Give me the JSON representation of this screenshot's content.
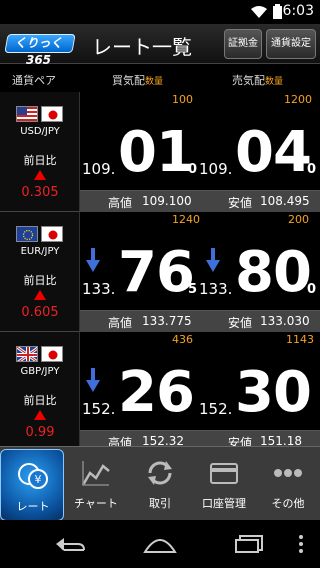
{
  "status": {
    "time": "16:03"
  },
  "header": {
    "logo": "くりっく365",
    "title": "レート一覧",
    "btn_margin": "証拠金",
    "btn_settings": "通貨設定"
  },
  "columns": {
    "pair": "通貨ペア",
    "bid": "買気配",
    "ask": "売気配",
    "qty": "数量"
  },
  "rows": [
    {
      "pair": "USD/JPY",
      "prev_label": "前日比",
      "prev_change": "0.305",
      "bid_qty": "100",
      "ask_qty": "1200",
      "bid_prefix": "109.",
      "bid_big": "01",
      "bid_suffix": "0",
      "ask_prefix": "109.",
      "ask_big": "04",
      "ask_suffix": "0",
      "high_label": "高値",
      "high": "109.100",
      "low_label": "安値",
      "low": "108.495"
    },
    {
      "pair": "EUR/JPY",
      "prev_label": "前日比",
      "prev_change": "0.605",
      "bid_qty": "1240",
      "ask_qty": "200",
      "bid_prefix": "133.",
      "bid_big": "76",
      "bid_suffix": "5",
      "ask_prefix": "133.",
      "ask_big": "80",
      "ask_suffix": "0",
      "high_label": "高値",
      "high": "133.775",
      "low_label": "安値",
      "low": "133.030"
    },
    {
      "pair": "GBP/JPY",
      "prev_label": "前日比",
      "prev_change": "0.99",
      "bid_qty": "436",
      "ask_qty": "1143",
      "bid_prefix": "152.",
      "bid_big": "26",
      "bid_suffix": "",
      "ask_prefix": "152.",
      "ask_big": "30",
      "ask_suffix": "",
      "high_label": "高値",
      "high": "152.32",
      "low_label": "安値",
      "low": "151.18"
    }
  ],
  "tabs": [
    {
      "label": "レート",
      "icon": "yen-coins-icon"
    },
    {
      "label": "チャート",
      "icon": "chart-icon"
    },
    {
      "label": "取引",
      "icon": "refresh-icon"
    },
    {
      "label": "口座管理",
      "icon": "card-icon"
    },
    {
      "label": "その他",
      "icon": "more-icon"
    }
  ],
  "colors": {
    "accent": "#f5a21b",
    "down": "#e22",
    "active_tab": "#2a9ff5"
  }
}
